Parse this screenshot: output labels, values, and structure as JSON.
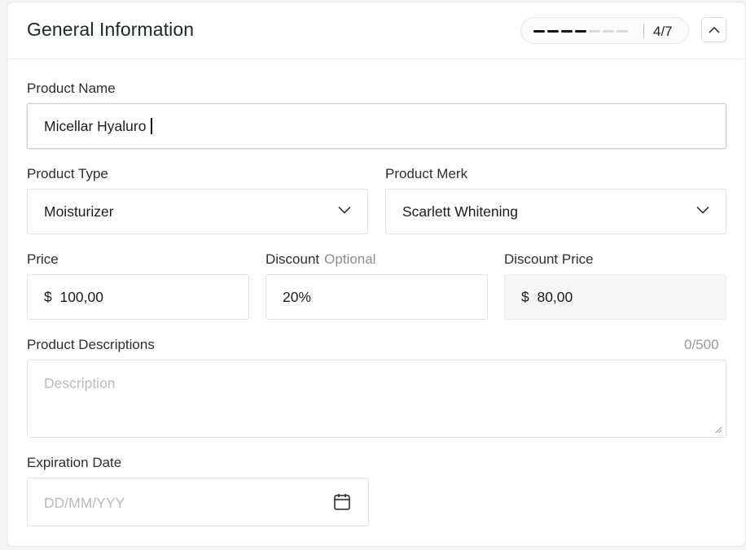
{
  "header": {
    "title": "General Information",
    "progress": {
      "current": 4,
      "total": 7,
      "label": "4/7"
    },
    "collapse_icon": "chevron-up-icon"
  },
  "form": {
    "product_name": {
      "label": "Product Name",
      "value": "Micellar Hyaluro"
    },
    "product_type": {
      "label": "Product Type",
      "value": "Moisturizer"
    },
    "product_merk": {
      "label": "Product Merk",
      "value": "Scarlett Whitening"
    },
    "price": {
      "label": "Price",
      "value": "$  100,00"
    },
    "discount": {
      "label": "Discount",
      "optional": "Optional",
      "value": "20%"
    },
    "discount_price": {
      "label": "Discount Price",
      "value": "$  80,00"
    },
    "descriptions": {
      "label": "Product Descriptions",
      "counter": "0/500",
      "placeholder": "Description"
    },
    "expiration_date": {
      "label": "Expiration Date",
      "placeholder": "DD/MM/YYY",
      "icon": "calendar-icon"
    }
  },
  "colors": {
    "progress_active": "#111111",
    "progress_inactive": "#d9d9d9",
    "border": "#e3e3e3"
  }
}
